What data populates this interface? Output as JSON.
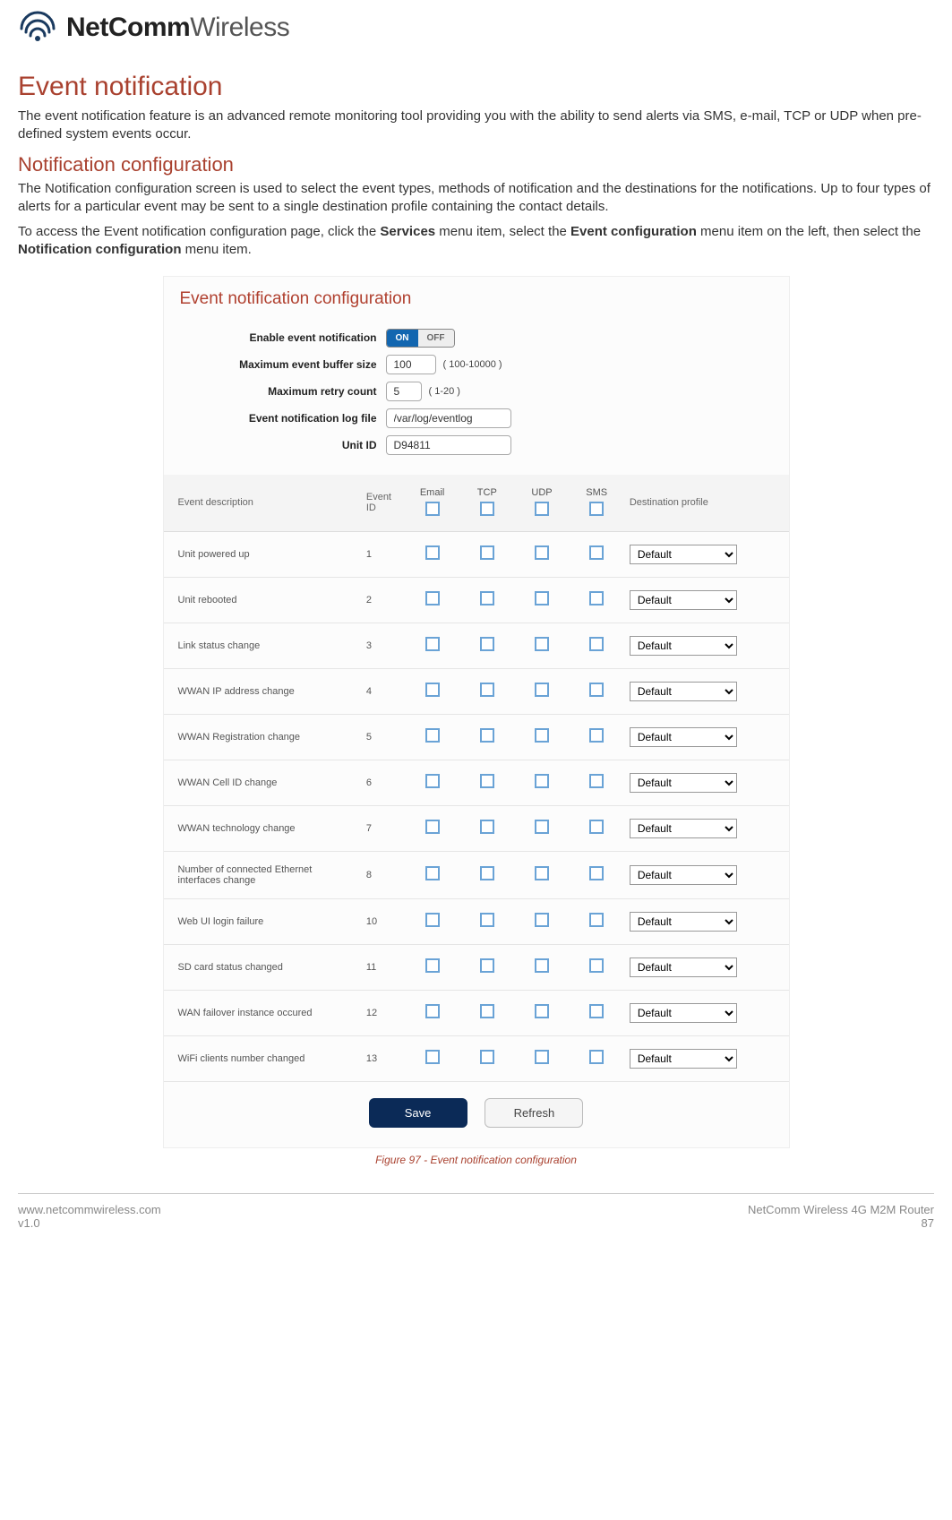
{
  "header": {
    "brand_bold": "NetComm",
    "brand_light": "Wireless"
  },
  "section": {
    "title": "Event notification",
    "intro": "The event notification feature is an advanced remote monitoring tool providing you with the ability to send alerts via SMS, e-mail, TCP or UDP when pre-defined system events occur.",
    "sub_title": "Notification configuration",
    "sub_intro": "The Notification configuration screen is used to select the event types, methods of notification and the destinations for the notifications. Up to four types of alerts for a particular event may be sent to a single destination profile containing the contact details.",
    "access_prefix": "To access the Event notification configuration page, click the ",
    "access_bold1": "Services",
    "access_mid1": " menu item, select the ",
    "access_bold2": "Event configuration",
    "access_mid2": " menu item on the left, then select the ",
    "access_bold3": "Notification configuration",
    "access_suffix": " menu item."
  },
  "panel": {
    "title": "Event notification configuration",
    "fields": {
      "enable_label": "Enable event notification",
      "toggle_on": "ON",
      "toggle_off": "OFF",
      "bufsize_label": "Maximum event buffer size",
      "bufsize_value": "100",
      "bufsize_hint": "( 100-10000 )",
      "retry_label": "Maximum retry count",
      "retry_value": "5",
      "retry_hint": "( 1-20 )",
      "logfile_label": "Event notification log file",
      "logfile_value": "/var/log/eventlog",
      "unitid_label": "Unit ID",
      "unitid_value": "D94811"
    },
    "columns": {
      "desc": "Event description",
      "id": "Event ID",
      "email": "Email",
      "tcp": "TCP",
      "udp": "UDP",
      "sms": "SMS",
      "dest": "Destination profile"
    },
    "default_option": "Default",
    "events": [
      {
        "desc": "Unit powered up",
        "id": "1"
      },
      {
        "desc": "Unit rebooted",
        "id": "2"
      },
      {
        "desc": "Link status change",
        "id": "3"
      },
      {
        "desc": "WWAN IP address change",
        "id": "4"
      },
      {
        "desc": "WWAN Registration change",
        "id": "5"
      },
      {
        "desc": "WWAN Cell ID change",
        "id": "6"
      },
      {
        "desc": "WWAN technology change",
        "id": "7"
      },
      {
        "desc": "Number of connected Ethernet interfaces change",
        "id": "8"
      },
      {
        "desc": "Web UI login failure",
        "id": "10"
      },
      {
        "desc": "SD card status changed",
        "id": "11"
      },
      {
        "desc": "WAN failover instance occured",
        "id": "12"
      },
      {
        "desc": "WiFi clients number changed",
        "id": "13"
      }
    ],
    "buttons": {
      "save": "Save",
      "refresh": "Refresh"
    }
  },
  "figure_caption": "Figure 97 - Event notification configuration",
  "footer": {
    "url": "www.netcommwireless.com",
    "version": "v1.0",
    "product": "NetComm Wireless 4G M2M Router",
    "page": "87"
  }
}
